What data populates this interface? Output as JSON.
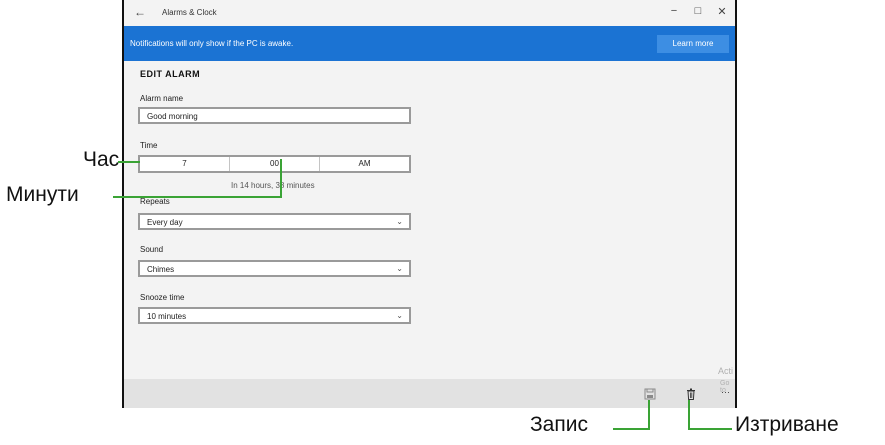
{
  "window": {
    "title": "Alarms & Clock",
    "back_icon": "back-arrow-icon",
    "minimize": "−",
    "maximize": "□",
    "close": "✕"
  },
  "banner": {
    "message": "Notifications will only show if the PC is awake.",
    "button_label": "Learn more",
    "color": "#1b73d3"
  },
  "form": {
    "heading": "EDIT ALARM",
    "name_label": "Alarm name",
    "name_value": "Good morning",
    "time_label": "Time",
    "hour": "7",
    "minute": "00",
    "ampm": "AM",
    "time_hint": "In 14 hours, 38 minutes",
    "repeats_label": "Repeats",
    "repeats_value": "Every day",
    "sound_label": "Sound",
    "sound_value": "Chimes",
    "snooze_label": "Snooze time",
    "snooze_value": "10 minutes"
  },
  "bottom_bar": {
    "save_icon": "save-icon",
    "delete_icon": "delete-icon",
    "more_label": "···"
  },
  "watermark": {
    "line1": "Acti",
    "line2": "Go to"
  },
  "annotations": {
    "hour": "Час",
    "minutes": "Минути",
    "save": "Запис",
    "delete": "Изтриване",
    "line_color": "#3aa335"
  }
}
